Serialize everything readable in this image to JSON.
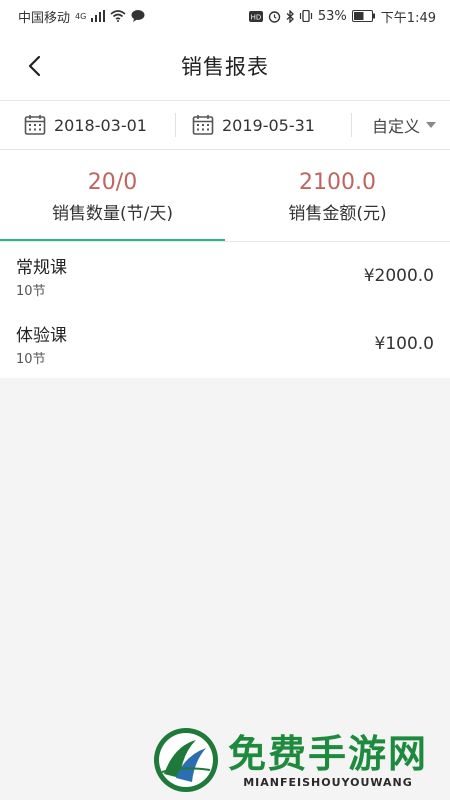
{
  "status_bar": {
    "carrier": "中国移动",
    "network": "4G",
    "battery_percent": "53%",
    "time": "下午1:49"
  },
  "header": {
    "title": "销售报表"
  },
  "date_filter": {
    "start_date": "2018-03-01",
    "end_date": "2019-05-31",
    "preset_label": "自定义"
  },
  "stats": [
    {
      "value": "20/0",
      "label": "销售数量(节/天)",
      "active": true
    },
    {
      "value": "2100.0",
      "label": "销售金额(元)",
      "active": false
    }
  ],
  "courses": [
    {
      "name": "常规课",
      "count": "10节",
      "amount": "¥2000.0"
    },
    {
      "name": "体验课",
      "count": "10节",
      "amount": "¥100.0"
    }
  ],
  "watermark": {
    "title": "免费手游网",
    "subtitle": "MIANFEISHOUYOUWANG"
  },
  "colors": {
    "accent": "#2db38d",
    "stat_value": "#c0645f"
  }
}
